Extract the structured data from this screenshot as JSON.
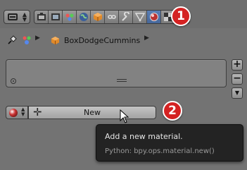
{
  "header": {
    "editor_type_icon": "editor-type-icon",
    "context_buttons": [
      {
        "name": "render-icon",
        "active": false
      },
      {
        "name": "render-layers-icon",
        "active": false
      },
      {
        "name": "scene-icon",
        "active": false
      },
      {
        "name": "world-icon",
        "active": false
      },
      {
        "name": "object-icon",
        "active": false
      },
      {
        "name": "constraints-icon",
        "active": false
      },
      {
        "name": "modifiers-icon",
        "active": false
      },
      {
        "name": "data-icon",
        "active": false
      },
      {
        "name": "material-icon",
        "active": true
      },
      {
        "name": "texture-icon",
        "active": false
      },
      {
        "name": "physics-icon",
        "active": false
      }
    ]
  },
  "annotations": {
    "step1": "1",
    "step2": "2"
  },
  "breadcrumb": {
    "object_name": "BoxDodgeCummins"
  },
  "material": {
    "new_label": "New"
  },
  "tooltip": {
    "title": "Add a new material.",
    "python": "Python: bpy.ops.material.new()"
  },
  "colors": {
    "panel_bg": "#737373",
    "accent_active": "#5a7fb7",
    "badge_red": "#d42222",
    "tooltip_bg": "#232323"
  }
}
